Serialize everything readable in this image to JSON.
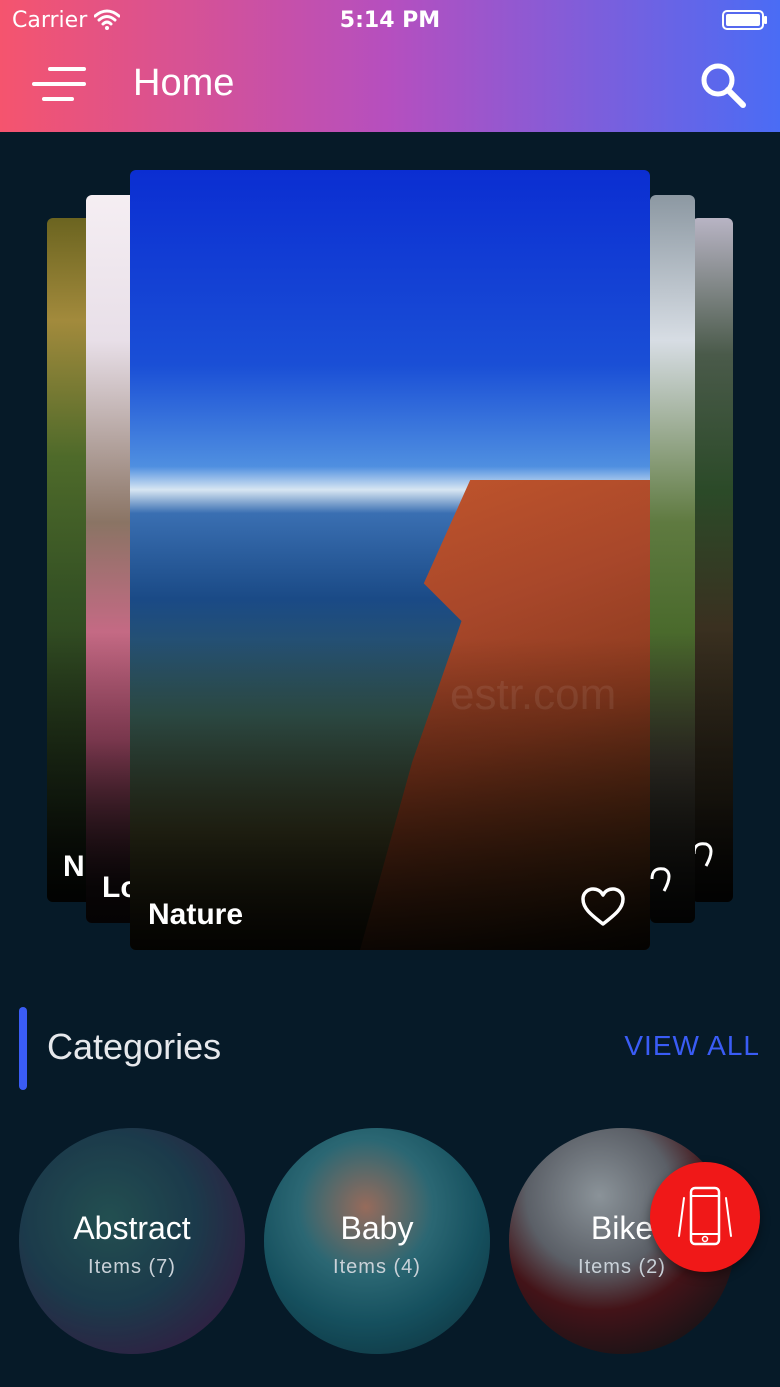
{
  "status_bar": {
    "carrier": "Carrier",
    "time": "5:14 PM"
  },
  "header": {
    "title": "Home"
  },
  "carousel": {
    "main_card": {
      "label": "Nature",
      "watermark": "estr.com"
    },
    "back_cards": [
      {
        "label": "N"
      },
      {
        "label": "Lo"
      }
    ]
  },
  "categories": {
    "title": "Categories",
    "view_all": "VIEW ALL",
    "items": [
      {
        "name": "Abstract",
        "count": "Items (7)"
      },
      {
        "name": "Baby",
        "count": "Items (4)"
      },
      {
        "name": "Bike",
        "count": "Items (2)"
      }
    ]
  },
  "colors": {
    "accent": "#3a5cf5",
    "fab": "#f01818",
    "background": "#061a28"
  }
}
